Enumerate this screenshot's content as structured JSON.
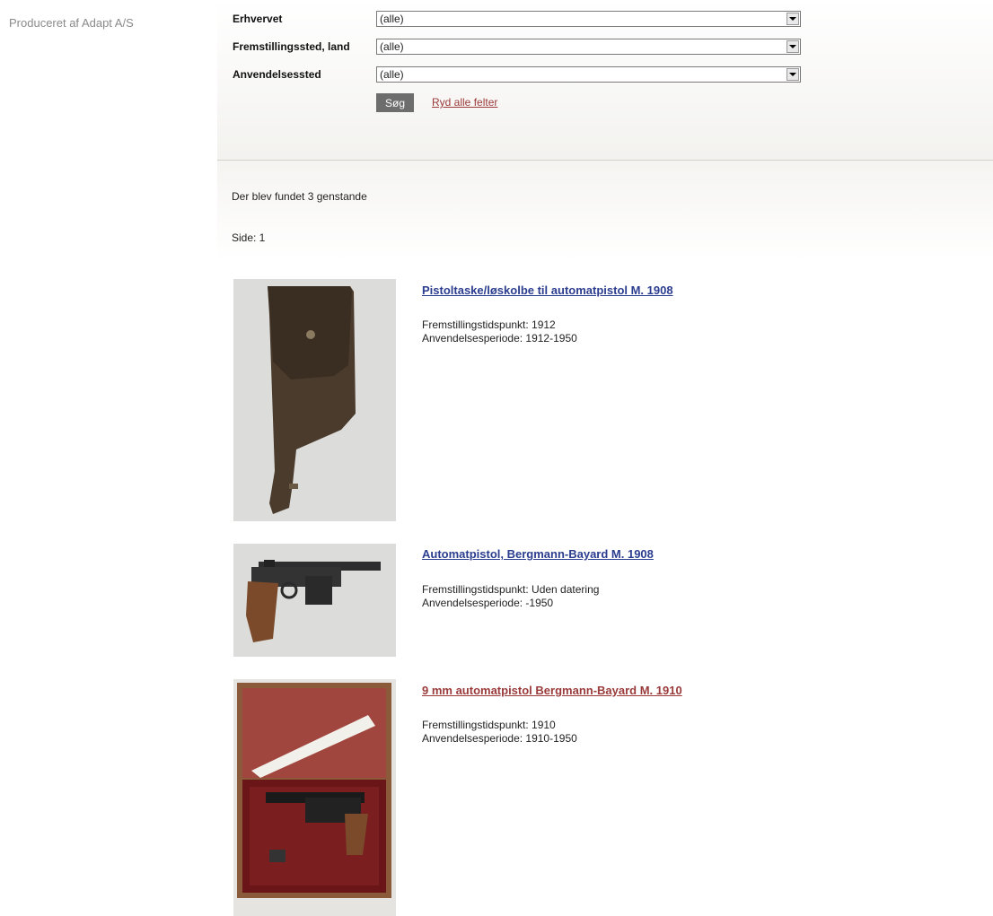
{
  "producer": "Produceret af Adapt A/S",
  "filters": [
    {
      "label": "Erhvervet",
      "value": "(alle)"
    },
    {
      "label": "Fremstillingssted, land",
      "value": "(alle)"
    },
    {
      "label": "Anvendelsessted",
      "value": "(alle)"
    }
  ],
  "search_button": "Søg",
  "clear_link": "Ryd alle felter",
  "results": {
    "found": "Der blev fundet 3 genstande",
    "page": "Side: 1"
  },
  "items": [
    {
      "title": "Pistoltaske/løskolbe til automatpistol M. 1908",
      "made": "Fremstillingstidspunkt: 1912",
      "period": "Anvendelsesperiode: 1912-1950",
      "visited": false
    },
    {
      "title": "Automatpistol, Bergmann-Bayard M. 1908",
      "made": "Fremstillingstidspunkt: Uden datering",
      "period": "Anvendelsesperiode: -1950",
      "visited": false
    },
    {
      "title": "9 mm automatpistol Bergmann-Bayard M. 1910",
      "made": "Fremstillingstidspunkt: 1910",
      "period": "Anvendelsesperiode: 1910-1950",
      "visited": true
    }
  ],
  "colors": {
    "link": "#2b3d8f",
    "visited_link": "#9a3a3a",
    "button_bg": "#6d6d6d"
  }
}
